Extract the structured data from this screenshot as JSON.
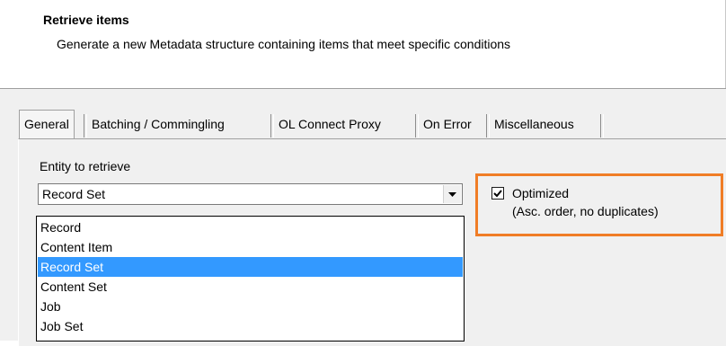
{
  "header": {
    "title": "Retrieve items",
    "subtitle": "Generate a new Metadata structure containing items that meet specific conditions"
  },
  "tabs": [
    {
      "label": "General",
      "active": true
    },
    {
      "label": "Batching / Commingling",
      "active": false
    },
    {
      "label": "OL Connect Proxy",
      "active": false
    },
    {
      "label": "On Error",
      "active": false
    },
    {
      "label": "Miscellaneous",
      "active": false
    }
  ],
  "entity": {
    "label": "Entity to retrieve",
    "selected": "Record Set",
    "options": [
      "Record",
      "Content Item",
      "Record Set",
      "Content Set",
      "Job",
      "Job Set"
    ],
    "arrow_icon": "chevron-down-icon"
  },
  "optimized": {
    "checked": true,
    "label": "Optimized",
    "note": "(Asc. order, no duplicates)",
    "highlight_color": "#f07d26"
  },
  "colors": {
    "selection": "#3399ff",
    "dialog_bg": "#f0f0f0"
  }
}
